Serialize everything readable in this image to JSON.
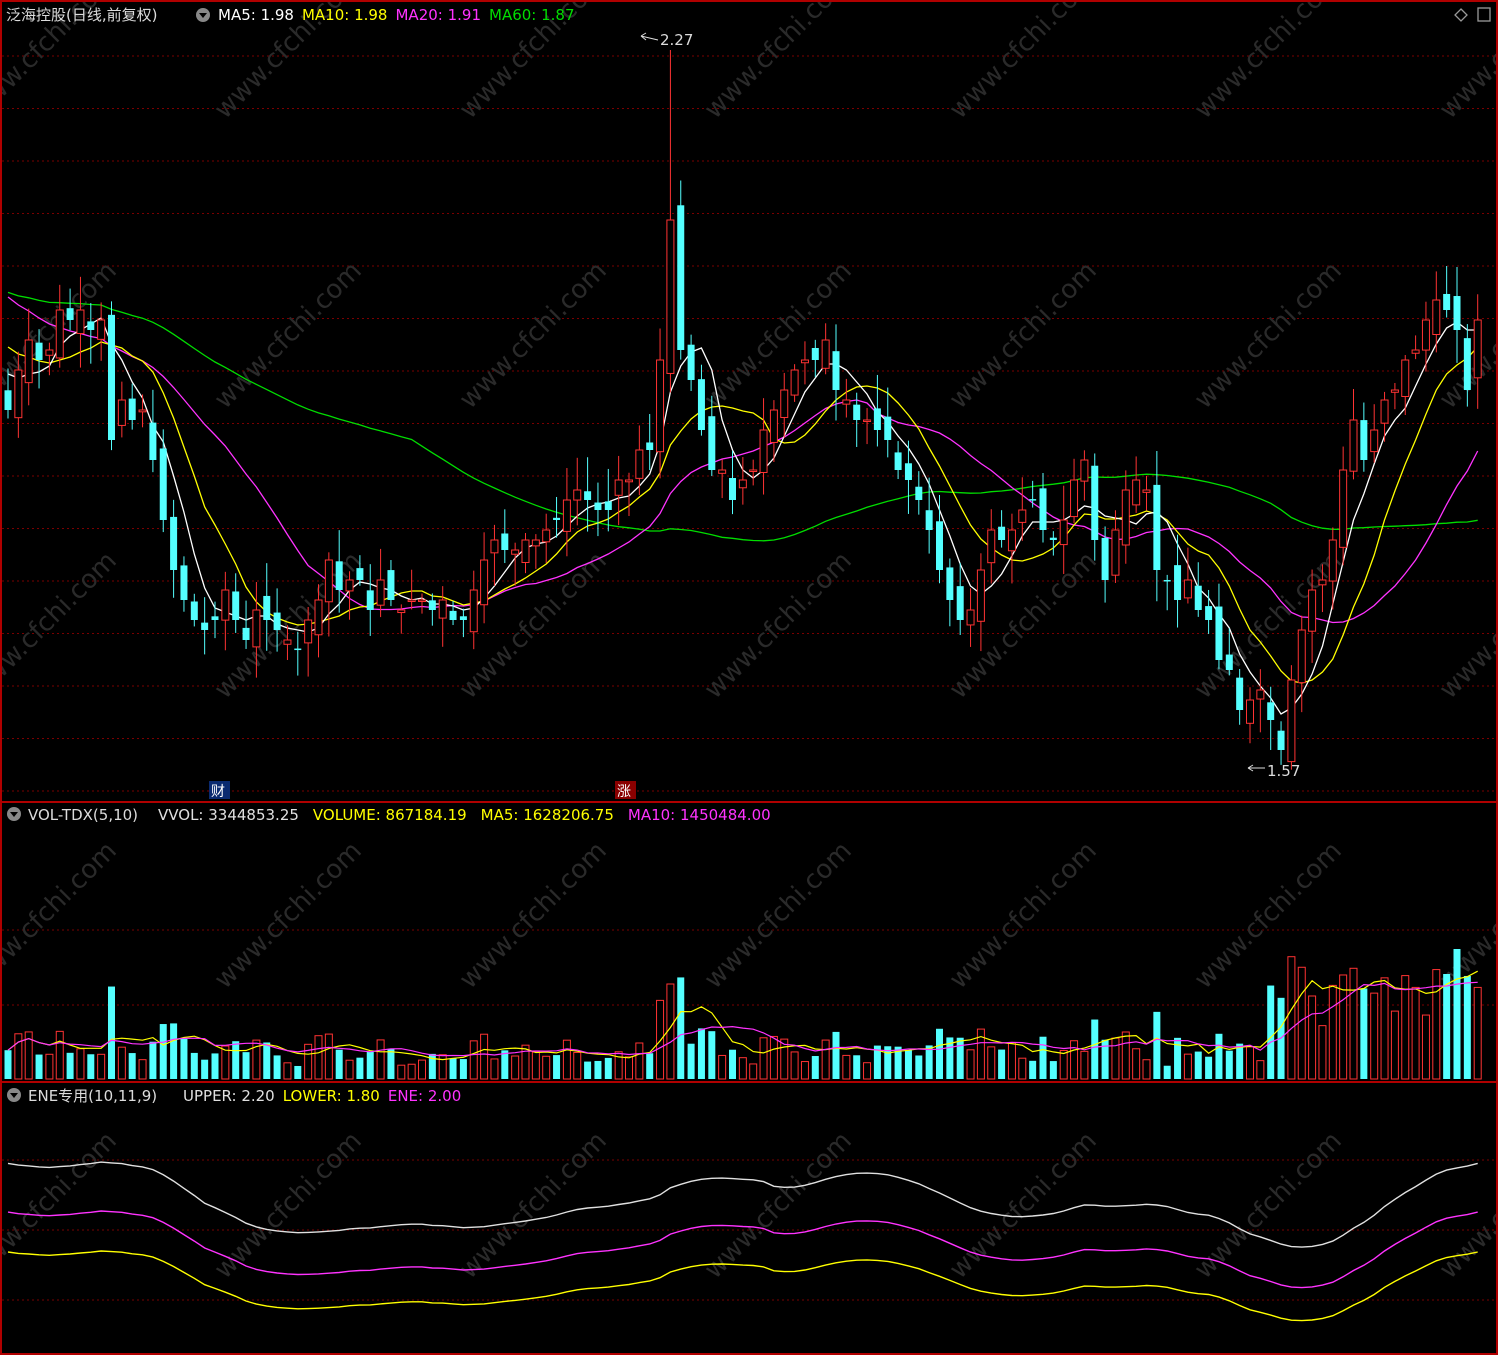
{
  "header": {
    "title": "泛海控股(日线,前复权)",
    "ma_labels": [
      {
        "label": "MA5: 1.98",
        "color": "#ffffff"
      },
      {
        "label": "MA10: 1.98",
        "color": "#ffff00"
      },
      {
        "label": "MA20: 1.91",
        "color": "#ff33ff"
      },
      {
        "label": "MA60: 1.87",
        "color": "#00dd00"
      }
    ]
  },
  "volume_header": {
    "name": "VOL-TDX(5,10)",
    "items": [
      {
        "label": "VVOL: 3344853.25",
        "color": "#e0e0e0"
      },
      {
        "label": "VOLUME: 867184.19",
        "color": "#ffff00"
      },
      {
        "label": "MA5: 1628206.75",
        "color": "#ffff00"
      },
      {
        "label": "MA10: 1450484.00",
        "color": "#ff33ff"
      }
    ]
  },
  "ene_header": {
    "name": "ENE专用(10,11,9)",
    "items": [
      {
        "label": "UPPER: 2.20",
        "color": "#e0e0e0"
      },
      {
        "label": "LOWER: 1.80",
        "color": "#ffff00"
      },
      {
        "label": "ENE: 2.00",
        "color": "#ff33ff"
      }
    ]
  },
  "annotations": {
    "high_label": "2.27",
    "low_label": "1.57",
    "marker_cai": "财",
    "marker_zhang": "涨"
  },
  "watermark": "www.cfchi.com",
  "colors": {
    "up": "#ff3333",
    "down": "#54ffff",
    "border": "#b00000",
    "grid": "#7a0000",
    "ma5": "#ffffff",
    "ma10": "#ffff00",
    "ma20": "#ff33ff",
    "ma60": "#00dd00"
  },
  "chart_data": {
    "type": "candlestick",
    "price_range": [
      1.52,
      2.29
    ],
    "high": 2.27,
    "low": 1.57,
    "closes": [
      1.91,
      1.95,
      1.98,
      1.96,
      1.97,
      2.01,
      2.0,
      2.01,
      1.99,
      2.0,
      1.88,
      1.92,
      1.9,
      1.91,
      1.86,
      1.8,
      1.75,
      1.72,
      1.7,
      1.69,
      1.7,
      1.73,
      1.7,
      1.68,
      1.71,
      1.7,
      1.69,
      1.68,
      1.67,
      1.7,
      1.72,
      1.76,
      1.73,
      1.74,
      1.74,
      1.71,
      1.74,
      1.72,
      1.71,
      1.72,
      1.72,
      1.71,
      1.72,
      1.7,
      1.7,
      1.73,
      1.76,
      1.78,
      1.77,
      1.77,
      1.78,
      1.78,
      1.79,
      1.8,
      1.82,
      1.83,
      1.82,
      1.81,
      1.81,
      1.84,
      1.84,
      1.87,
      1.87,
      1.96,
      2.1,
      1.97,
      1.94,
      1.89,
      1.85,
      1.85,
      1.82,
      1.84,
      1.85,
      1.89,
      1.91,
      1.93,
      1.95,
      1.96,
      1.96,
      1.98,
      1.93,
      1.92,
      1.9,
      1.9,
      1.89,
      1.88,
      1.85,
      1.84,
      1.82,
      1.79,
      1.75,
      1.72,
      1.7,
      1.71,
      1.75,
      1.79,
      1.78,
      1.79,
      1.81,
      1.82,
      1.79,
      1.78,
      1.8,
      1.84,
      1.86,
      1.78,
      1.74,
      1.79,
      1.83,
      1.84,
      1.83,
      1.75,
      1.74,
      1.72,
      1.74,
      1.71,
      1.7,
      1.66,
      1.65,
      1.61,
      1.62,
      1.63,
      1.6,
      1.57,
      1.64,
      1.69,
      1.73,
      1.74,
      1.78,
      1.85,
      1.9,
      1.86,
      1.89,
      1.92,
      1.93,
      1.96,
      1.97,
      2.0,
      2.02,
      2.01,
      1.99,
      1.93,
      2.0
    ]
  }
}
